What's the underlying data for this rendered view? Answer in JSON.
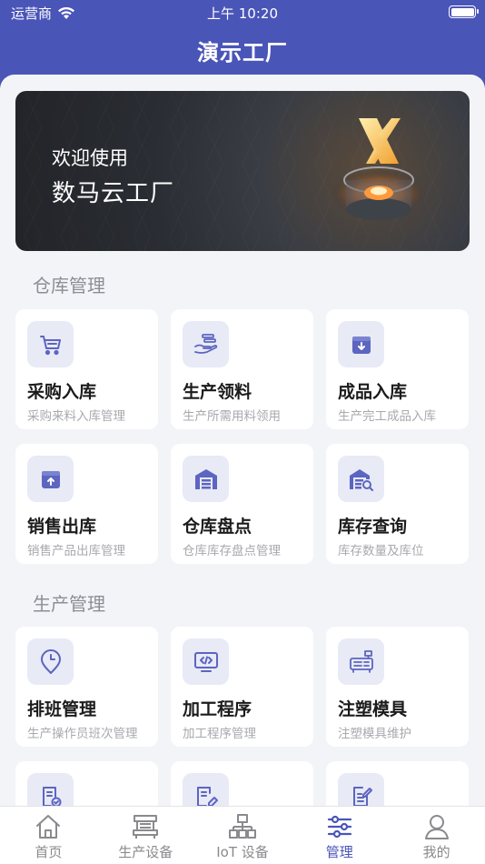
{
  "status_bar": {
    "carrier": "运营商",
    "time": "上午 10:20"
  },
  "app_title": "演示工厂",
  "banner": {
    "welcome": "欢迎使用",
    "brand": "数马云工厂"
  },
  "sections": [
    {
      "title": "仓库管理",
      "cards": [
        {
          "icon": "cart-icon",
          "title": "采购入库",
          "desc": "采购来料入库管理"
        },
        {
          "icon": "hand-coins-icon",
          "title": "生产领料",
          "desc": "生产所需用料领用"
        },
        {
          "icon": "inbox-in-icon",
          "title": "成品入库",
          "desc": "生产完工成品入库"
        },
        {
          "icon": "box-out-icon",
          "title": "销售出库",
          "desc": "销售产品出库管理"
        },
        {
          "icon": "warehouse-icon",
          "title": "仓库盘点",
          "desc": "仓库库存盘点管理"
        },
        {
          "icon": "warehouse-search-icon",
          "title": "库存查询",
          "desc": "库存数量及库位"
        }
      ]
    },
    {
      "title": "生产管理",
      "cards": [
        {
          "icon": "clock-pin-icon",
          "title": "排班管理",
          "desc": "生产操作员班次管理"
        },
        {
          "icon": "code-monitor-icon",
          "title": "加工程序",
          "desc": "加工程序管理"
        },
        {
          "icon": "mold-machine-icon",
          "title": "注塑模具",
          "desc": "注塑模具维护"
        },
        {
          "icon": "doc-check-icon",
          "title": "",
          "desc": ""
        },
        {
          "icon": "doc-edit-icon",
          "title": "",
          "desc": ""
        },
        {
          "icon": "doc-write-icon",
          "title": "",
          "desc": ""
        }
      ]
    }
  ],
  "tabs": [
    {
      "icon": "home-icon",
      "label": "首页",
      "active": false
    },
    {
      "icon": "machine-icon",
      "label": "生产设备",
      "active": false
    },
    {
      "icon": "network-icon",
      "label": "IoT 设备",
      "active": false
    },
    {
      "icon": "sliders-icon",
      "label": "管理",
      "active": true
    },
    {
      "icon": "user-icon",
      "label": "我的",
      "active": false
    }
  ],
  "colors": {
    "primary": "#4a55b8",
    "icon_bg": "#e8eaf6",
    "page_bg": "#f3f4f7"
  }
}
